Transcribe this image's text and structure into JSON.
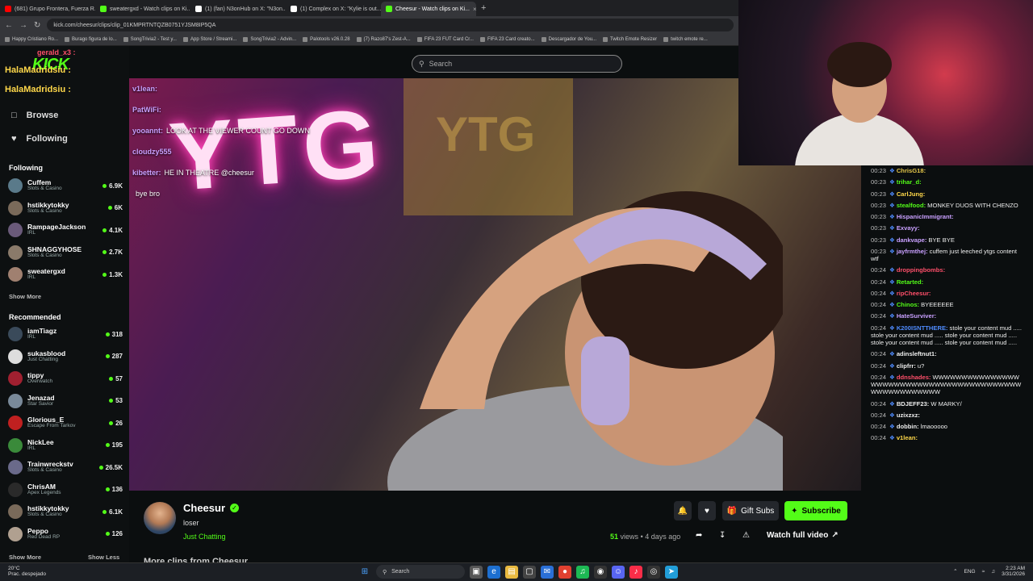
{
  "browser": {
    "tabs": [
      {
        "label": "(681) Grupo Frontera, Fuerza R...",
        "color": "#ff0000"
      },
      {
        "label": "sweatergxd - Watch clips on Ki...",
        "color": "#53fc18"
      },
      {
        "label": "(1) (fan) N3onHub on X: \"N3on...",
        "color": "#ffffff"
      },
      {
        "label": "(1) Complex on X: \"Kylie is out...",
        "color": "#ffffff"
      },
      {
        "label": "Cheesur - Watch clips on Ki...",
        "color": "#53fc18",
        "active": true
      }
    ],
    "url": "kick.com/cheesur/clips/clip_01KMPRTNTQZB0751YJSM8IP5QA",
    "bookmarks": [
      "Happy Cristiano Ro...",
      "Burago figura de lo...",
      "SongTrivia2 - Test y...",
      "App Store / Streami...",
      "SongTrivia2 - Advin...",
      "Palotools v26.0.28",
      "(7) Razo87's Zest-A...",
      "FIFA 23 FUT Card Cr...",
      "FIFA 23 Card creato...",
      "Descargador de You...",
      "Twitch Emote Resizer",
      "twitch emote re..."
    ]
  },
  "brand": {
    "logo": "KICK"
  },
  "overlay_chat": [
    {
      "user": "HalaMadridsiu :"
    },
    {
      "user": "HalaMadridsiu :"
    },
    {
      "user": "gerald_x3 :"
    }
  ],
  "nav": {
    "browse": "Browse",
    "following": "Following"
  },
  "following": {
    "title": "Following",
    "channels": [
      {
        "name": "Cuffem",
        "category": "Slots & Casino",
        "viewers": "6.9K",
        "color": "#5a7a8a"
      },
      {
        "name": "hstikkytokky",
        "category": "Slots & Casino",
        "viewers": "6K",
        "color": "#7a6a5a"
      },
      {
        "name": "RampageJackson",
        "category": "IRL",
        "viewers": "4.1K",
        "color": "#6a5a7a"
      },
      {
        "name": "SHNAGGYHOSE",
        "category": "Slots & Casino",
        "viewers": "2.7K",
        "color": "#8a7a6a"
      },
      {
        "name": "sweatergxd",
        "category": "IRL",
        "viewers": "1.3K",
        "color": "#a08070"
      }
    ],
    "show_more": "Show More"
  },
  "recommended": {
    "title": "Recommended",
    "channels": [
      {
        "name": "iamTiagz",
        "category": "IRL",
        "viewers": "318",
        "color": "#3a4a5a"
      },
      {
        "name": "sukasblood",
        "category": "Just Chatting",
        "viewers": "287",
        "color": "#dddddd"
      },
      {
        "name": "tippy",
        "category": "Overwatch",
        "viewers": "57",
        "color": "#a02030"
      },
      {
        "name": "Jenazad",
        "category": "Star Savior",
        "viewers": "53",
        "color": "#7a8a9a"
      },
      {
        "name": "Glorious_E",
        "category": "Escape From Tarkov",
        "viewers": "26",
        "color": "#c02020"
      },
      {
        "name": "NickLee",
        "category": "IRL",
        "viewers": "195",
        "color": "#3a8a3a"
      },
      {
        "name": "Trainwreckstv",
        "category": "Slots & Casino",
        "viewers": "26.5K",
        "color": "#6a6a8a"
      },
      {
        "name": "ChrisAM",
        "category": "Apex Legends",
        "viewers": "136",
        "color": "#2a2a2a"
      },
      {
        "name": "hstikkytokky",
        "category": "Slots & Casino",
        "viewers": "6.1K",
        "color": "#7a6a5a"
      },
      {
        "name": "Peppo",
        "category": "Red Dead RP",
        "viewers": "126",
        "color": "#b0a090"
      }
    ],
    "show_more": "Show More",
    "show_less": "Show Less"
  },
  "search": {
    "placeholder": "Search"
  },
  "video_overlay_chat": [
    {
      "user": "v1lean:",
      "msg": ""
    },
    {
      "user": "PatWiFi:",
      "msg": ""
    },
    {
      "user": "yooannt:",
      "msg": "LOOK AT THE VIEWER COUNT GO DOWN"
    },
    {
      "user": "cloudzy555",
      "msg": ""
    },
    {
      "user": "kibetter:",
      "msg": "HE IN THEATRE @cheesur"
    },
    {
      "user": "",
      "msg": "bye bro"
    }
  ],
  "neon_sign": "YTG",
  "chat": [
    {
      "time": "00:23",
      "user": "ChrisG18:",
      "msg": "",
      "color": "#e6c84a"
    },
    {
      "time": "00:23",
      "user": "trihar_d:",
      "msg": "",
      "color": "#53fc18"
    },
    {
      "time": "00:23",
      "user": "CarlJung:",
      "msg": "",
      "color": "#ffd84a"
    },
    {
      "time": "00:23",
      "user": "stealfood:",
      "msg": "MONKEY DUOS WITH CHENZO",
      "color": "#53fc18"
    },
    {
      "time": "00:23",
      "user": "HispanicImmigrant:",
      "msg": "",
      "color": "#c9a0ff"
    },
    {
      "time": "00:23",
      "user": "Exvayy:",
      "msg": "",
      "color": "#c9a0ff"
    },
    {
      "time": "00:23",
      "user": "dankvape:",
      "msg": "BYE BYE",
      "color": "#c9a0ff"
    },
    {
      "time": "00:23",
      "user": "jayfrmthej:",
      "msg": "cuffem just leeched ytgs content wtf",
      "color": "#c9a0ff"
    },
    {
      "time": "00:24",
      "user": "droppingbombs:",
      "msg": "",
      "color": "#ff4f6a"
    },
    {
      "time": "00:24",
      "user": "Retarted:",
      "msg": "",
      "color": "#53fc18"
    },
    {
      "time": "00:24",
      "user": "ripCheesur:",
      "msg": "",
      "color": "#ff4f6a"
    },
    {
      "time": "00:24",
      "user": "Chinos:",
      "msg": "BYEEEEEE",
      "color": "#53fc18"
    },
    {
      "time": "00:24",
      "user": "HateSurviver:",
      "msg": "",
      "color": "#c9a0ff"
    },
    {
      "time": "00:24",
      "user": "K200ISNTTHERE:",
      "msg": "stole your content mud ..... stole your content mud ..... stole your content mud ..... stole your content mud ..... stole your content mud .....",
      "color": "#4f8cff"
    },
    {
      "time": "00:24",
      "user": "adinsleftnut1:",
      "msg": "",
      "color": "#eeeeee"
    },
    {
      "time": "00:24",
      "user": "clipfrr:",
      "msg": "u?",
      "color": "#eeeeee"
    },
    {
      "time": "00:24",
      "user": "ddnshades:",
      "msg": "WWWWWWWWWWWWWWWWWWWWWWWWWWWWWWWWWWWWWWWWWWWWWWWWWWWWW",
      "color": "#ff4f6a"
    },
    {
      "time": "00:24",
      "user": "BDJEFF23:",
      "msg": "W MARKY/",
      "color": "#eeeeee"
    },
    {
      "time": "00:24",
      "user": "uzixzxz:",
      "msg": "",
      "color": "#eeeeee"
    },
    {
      "time": "00:24",
      "user": "dobbin:",
      "msg": "lmaooooo",
      "color": "#eeeeee"
    },
    {
      "time": "00:24",
      "user": "v1lean:",
      "msg": "",
      "color": "#ffd84a"
    }
  ],
  "clip": {
    "channel": "Cheesur",
    "title": "loser",
    "category": "Just Chatting",
    "views": "51",
    "views_label": "views",
    "age": "• 4 days ago",
    "gift_subs": "Gift Subs",
    "subscribe": "Subscribe",
    "watch_full": "Watch full video",
    "more_clips": "More clips from Cheesur"
  },
  "taskbar": {
    "temp": "20°C",
    "weather": "Prac. despejado",
    "search": "Search",
    "lang": "ENG",
    "time": "2:23 AM",
    "date": "3/31/2026"
  }
}
